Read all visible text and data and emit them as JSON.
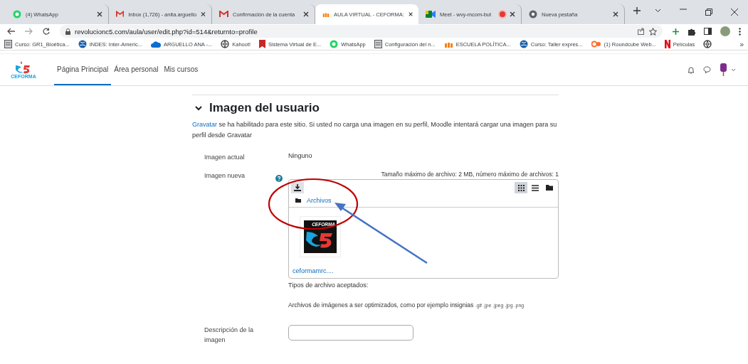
{
  "browser": {
    "tabs": [
      {
        "title": "(4) WhatsApp",
        "selected": false,
        "recording": false
      },
      {
        "title": "Inbox (1,726) - anita.arguello",
        "selected": false,
        "recording": false
      },
      {
        "title": "Confirmación de la cuenta",
        "selected": false,
        "recording": false
      },
      {
        "title": "AULA VIRTUAL - CEFORMA:",
        "selected": true,
        "recording": false
      },
      {
        "title": "Meet - wvy-mcom-but",
        "selected": false,
        "recording": true
      },
      {
        "title": "Nueva pestaña",
        "selected": false,
        "recording": false
      }
    ],
    "url": "revolucionc5.com/aula/user/edit.php?id=514&returnto=profile",
    "bookmarks": [
      {
        "label": "Curso: GR1_Bioética..."
      },
      {
        "label": "INDES: Inter-Americ..."
      },
      {
        "label": "ARGUELLO ANA -..."
      },
      {
        "label": "Kahoot!"
      },
      {
        "label": "Sistema Virtual de E..."
      },
      {
        "label": "WhatsApp"
      },
      {
        "label": "Configuración del n..."
      },
      {
        "label": "ESCUELA POLÍTICA..."
      },
      {
        "label": "Curso: Taller expres..."
      },
      {
        "label": "(1) Roundcube Web..."
      },
      {
        "label": "Películas"
      }
    ],
    "bookmarks_overflow": "»"
  },
  "navbar": {
    "logo_text": "CEFORMA",
    "items": [
      {
        "label": "Página Principal",
        "selected": true
      },
      {
        "label": "Área personal",
        "selected": false
      },
      {
        "label": "Mis cursos",
        "selected": false
      }
    ]
  },
  "section": {
    "title": "Imagen del usuario",
    "expanded": true,
    "intro_link": "Gravatar",
    "intro_text": "se ha habilitado para este sitio. Si usted no carga una imagen en su perfil, Moodle intentará cargar una imagen para su perfil desde Gravatar",
    "current_image": {
      "label": "Imagen actual",
      "value": "Ninguno"
    },
    "new_image": {
      "label": "Imagen nueva",
      "limits": "Tamaño máximo de archivo: 2 MB, número máximo de archivos: 1",
      "views": [
        {
          "kind": "grid",
          "selected": true
        },
        {
          "kind": "list",
          "selected": false
        },
        {
          "kind": "tree",
          "selected": false
        }
      ],
      "path": "Archivos",
      "files": [
        {
          "name": "ceformamrc....",
          "thumb_text": "CEFORMA"
        }
      ]
    },
    "accepted_label": "Tipos de archivo aceptados:",
    "accepted_text": "Archivos de imágenes a ser optimizados, como por ejemplo insignias",
    "accepted_extensions": ".gif .jpe .jpeg .jpg .png",
    "description": {
      "label": "Descripción de la imagen"
    }
  }
}
